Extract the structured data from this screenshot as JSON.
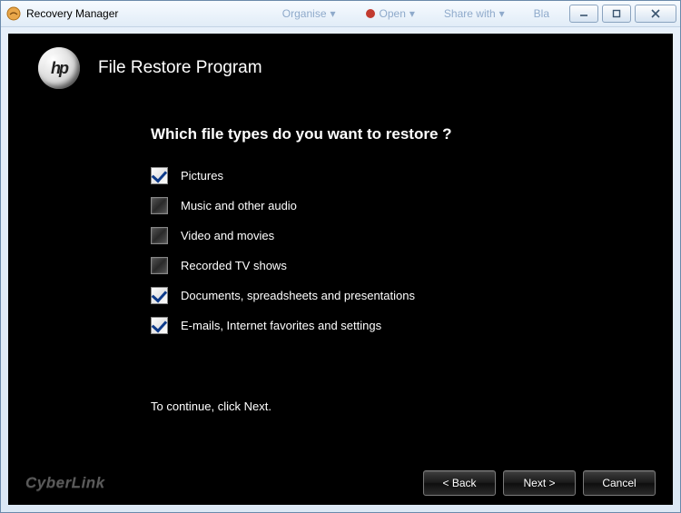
{
  "window": {
    "title": "Recovery Manager",
    "bg_tools": {
      "organise": "Organise",
      "open": "Open",
      "share": "Share with",
      "bla": "Bla"
    }
  },
  "header": {
    "logo_text": "hp",
    "program_title": "File Restore Program"
  },
  "content": {
    "question": "Which file types do you want to restore ?",
    "options": [
      {
        "label": "Pictures",
        "checked": true
      },
      {
        "label": "Music and other audio",
        "checked": false
      },
      {
        "label": "Video and movies",
        "checked": false
      },
      {
        "label": "Recorded TV shows",
        "checked": false
      },
      {
        "label": "Documents, spreadsheets and presentations",
        "checked": true
      },
      {
        "label": "E-mails, Internet favorites and settings",
        "checked": true
      }
    ],
    "hint": "To continue, click Next."
  },
  "footer": {
    "brand": "CyberLink",
    "back": "< Back",
    "next": "Next >",
    "cancel": "Cancel"
  }
}
